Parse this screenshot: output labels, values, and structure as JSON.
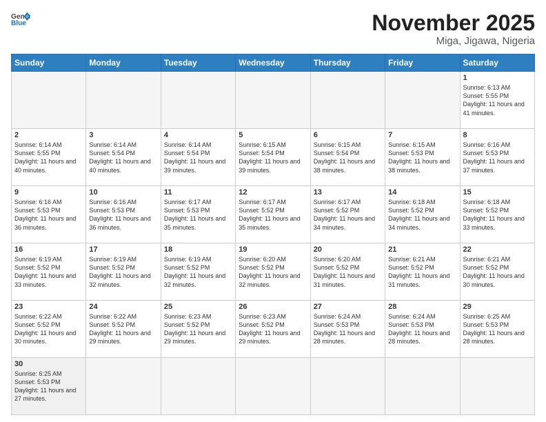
{
  "header": {
    "logo_general": "General",
    "logo_blue": "Blue",
    "month_title": "November 2025",
    "location": "Miga, Jigawa, Nigeria"
  },
  "weekdays": [
    "Sunday",
    "Monday",
    "Tuesday",
    "Wednesday",
    "Thursday",
    "Friday",
    "Saturday"
  ],
  "weeks": [
    [
      {
        "day": "",
        "info": ""
      },
      {
        "day": "",
        "info": ""
      },
      {
        "day": "",
        "info": ""
      },
      {
        "day": "",
        "info": ""
      },
      {
        "day": "",
        "info": ""
      },
      {
        "day": "",
        "info": ""
      },
      {
        "day": "1",
        "info": "Sunrise: 6:13 AM\nSunset: 5:55 PM\nDaylight: 11 hours and 41 minutes."
      }
    ],
    [
      {
        "day": "2",
        "info": "Sunrise: 6:14 AM\nSunset: 5:55 PM\nDaylight: 11 hours and 40 minutes."
      },
      {
        "day": "3",
        "info": "Sunrise: 6:14 AM\nSunset: 5:54 PM\nDaylight: 11 hours and 40 minutes."
      },
      {
        "day": "4",
        "info": "Sunrise: 6:14 AM\nSunset: 5:54 PM\nDaylight: 11 hours and 39 minutes."
      },
      {
        "day": "5",
        "info": "Sunrise: 6:15 AM\nSunset: 5:54 PM\nDaylight: 11 hours and 39 minutes."
      },
      {
        "day": "6",
        "info": "Sunrise: 6:15 AM\nSunset: 5:54 PM\nDaylight: 11 hours and 38 minutes."
      },
      {
        "day": "7",
        "info": "Sunrise: 6:15 AM\nSunset: 5:53 PM\nDaylight: 11 hours and 38 minutes."
      },
      {
        "day": "8",
        "info": "Sunrise: 6:16 AM\nSunset: 5:53 PM\nDaylight: 11 hours and 37 minutes."
      }
    ],
    [
      {
        "day": "9",
        "info": "Sunrise: 6:16 AM\nSunset: 5:53 PM\nDaylight: 11 hours and 36 minutes."
      },
      {
        "day": "10",
        "info": "Sunrise: 6:16 AM\nSunset: 5:53 PM\nDaylight: 11 hours and 36 minutes."
      },
      {
        "day": "11",
        "info": "Sunrise: 6:17 AM\nSunset: 5:53 PM\nDaylight: 11 hours and 35 minutes."
      },
      {
        "day": "12",
        "info": "Sunrise: 6:17 AM\nSunset: 5:52 PM\nDaylight: 11 hours and 35 minutes."
      },
      {
        "day": "13",
        "info": "Sunrise: 6:17 AM\nSunset: 5:52 PM\nDaylight: 11 hours and 34 minutes."
      },
      {
        "day": "14",
        "info": "Sunrise: 6:18 AM\nSunset: 5:52 PM\nDaylight: 11 hours and 34 minutes."
      },
      {
        "day": "15",
        "info": "Sunrise: 6:18 AM\nSunset: 5:52 PM\nDaylight: 11 hours and 33 minutes."
      }
    ],
    [
      {
        "day": "16",
        "info": "Sunrise: 6:19 AM\nSunset: 5:52 PM\nDaylight: 11 hours and 33 minutes."
      },
      {
        "day": "17",
        "info": "Sunrise: 6:19 AM\nSunset: 5:52 PM\nDaylight: 11 hours and 32 minutes."
      },
      {
        "day": "18",
        "info": "Sunrise: 6:19 AM\nSunset: 5:52 PM\nDaylight: 11 hours and 32 minutes."
      },
      {
        "day": "19",
        "info": "Sunrise: 6:20 AM\nSunset: 5:52 PM\nDaylight: 11 hours and 32 minutes."
      },
      {
        "day": "20",
        "info": "Sunrise: 6:20 AM\nSunset: 5:52 PM\nDaylight: 11 hours and 31 minutes."
      },
      {
        "day": "21",
        "info": "Sunrise: 6:21 AM\nSunset: 5:52 PM\nDaylight: 11 hours and 31 minutes."
      },
      {
        "day": "22",
        "info": "Sunrise: 6:21 AM\nSunset: 5:52 PM\nDaylight: 11 hours and 30 minutes."
      }
    ],
    [
      {
        "day": "23",
        "info": "Sunrise: 6:22 AM\nSunset: 5:52 PM\nDaylight: 11 hours and 30 minutes."
      },
      {
        "day": "24",
        "info": "Sunrise: 6:22 AM\nSunset: 5:52 PM\nDaylight: 11 hours and 29 minutes."
      },
      {
        "day": "25",
        "info": "Sunrise: 6:23 AM\nSunset: 5:52 PM\nDaylight: 11 hours and 29 minutes."
      },
      {
        "day": "26",
        "info": "Sunrise: 6:23 AM\nSunset: 5:52 PM\nDaylight: 11 hours and 29 minutes."
      },
      {
        "day": "27",
        "info": "Sunrise: 6:24 AM\nSunset: 5:53 PM\nDaylight: 11 hours and 28 minutes."
      },
      {
        "day": "28",
        "info": "Sunrise: 6:24 AM\nSunset: 5:53 PM\nDaylight: 11 hours and 28 minutes."
      },
      {
        "day": "29",
        "info": "Sunrise: 6:25 AM\nSunset: 5:53 PM\nDaylight: 11 hours and 28 minutes."
      }
    ],
    [
      {
        "day": "30",
        "info": "Sunrise: 6:25 AM\nSunset: 5:53 PM\nDaylight: 11 hours and 27 minutes."
      },
      {
        "day": "",
        "info": ""
      },
      {
        "day": "",
        "info": ""
      },
      {
        "day": "",
        "info": ""
      },
      {
        "day": "",
        "info": ""
      },
      {
        "day": "",
        "info": ""
      },
      {
        "day": "",
        "info": ""
      }
    ]
  ]
}
